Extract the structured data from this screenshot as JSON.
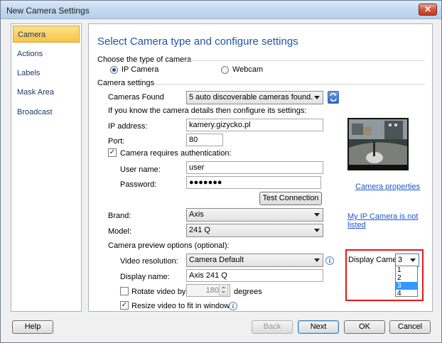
{
  "window": {
    "title": "New Camera Settings",
    "close_glyph": "✕"
  },
  "nav": {
    "items": [
      {
        "label": "Camera",
        "active": true
      },
      {
        "label": "Actions"
      },
      {
        "label": "Labels"
      },
      {
        "label": "Mask Area"
      },
      {
        "label": "Broadcast"
      }
    ]
  },
  "panel": {
    "heading": "Select Camera type and configure settings",
    "camera_type": {
      "title": "Choose the type of camera",
      "ip_label": "IP Camera",
      "webcam_label": "Webcam",
      "selected": "IP Camera"
    },
    "settings": {
      "title": "Camera settings",
      "cameras_found_label": "Cameras Found",
      "cameras_found_value": "5 auto discoverable cameras found.",
      "hint": "If you know the camera details then configure its settings:",
      "ip_label": "IP address:",
      "ip_value": "kamery.gizycko.pl",
      "port_label": "Port:",
      "port_value": "80",
      "auth_label": "Camera requires authentication:",
      "auth_checked": true,
      "username_label": "User name:",
      "username_value": "user",
      "password_label": "Password:",
      "password_value": "●●●●●●●",
      "test_button": "Test Connection",
      "brand_label": "Brand:",
      "brand_value": "Axis",
      "model_label": "Model:",
      "model_value": "241 Q",
      "camera_properties_link": "Camera properties",
      "not_listed_link": "My IP Camera is not listed"
    },
    "preview_options": {
      "title": "Camera preview options (optional):",
      "video_res_label": "Video resolution:",
      "video_res_value": "Camera Default",
      "display_name_label": "Display name:",
      "display_name_value": "Axis 241 Q",
      "rotate_label": "Rotate video by:",
      "rotate_checked": false,
      "rotate_value": "180",
      "degrees_label": "degrees",
      "resize_label": "Resize video to fit in window",
      "resize_checked": true,
      "display_camera_label": "Display Camera:",
      "display_camera_value": "3",
      "display_camera_options": [
        "1",
        "2",
        "3",
        "4"
      ],
      "highlighted_option": "3"
    }
  },
  "footer": {
    "help": "Help",
    "back": "Back",
    "next": "Next",
    "ok": "OK",
    "cancel": "Cancel"
  },
  "colors": {
    "accent": "#1f55a8",
    "link": "#1f55c8",
    "highlight_border": "#e01818",
    "nav_active": "#f7c445"
  }
}
